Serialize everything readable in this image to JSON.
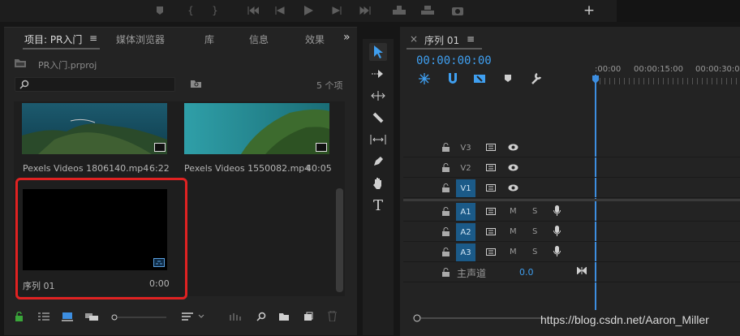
{
  "project_panel": {
    "tabs": [
      {
        "label": "项目: PR入门"
      },
      {
        "label": "媒体浏览器"
      },
      {
        "label": "库"
      },
      {
        "label": "信息"
      },
      {
        "label": "效果"
      }
    ],
    "overflow_glyph": "»",
    "menu_glyph": "≡",
    "project_file": "PR入门.prproj",
    "search_placeholder": "",
    "item_count": "5 个项",
    "items": [
      {
        "name": "Pexels Videos 1806140.mp4",
        "duration": "6:22"
      },
      {
        "name": "Pexels Videos 1550082.mp4",
        "duration": "40:05"
      },
      {
        "name": "序列 01",
        "duration": "0:00"
      }
    ]
  },
  "sequence_panel": {
    "close_glyph": "×",
    "tab_label": "序列 01",
    "menu_glyph": "≡",
    "timecode": "00:00:00:00",
    "ruler": [
      ":00:00",
      "00:00:15:00",
      "00:00:30:00"
    ],
    "video_tracks": [
      {
        "label": "V3",
        "active": false
      },
      {
        "label": "V2",
        "active": false
      },
      {
        "label": "V1",
        "active": true
      }
    ],
    "audio_tracks": [
      {
        "label": "A1",
        "m": "M",
        "s": "S"
      },
      {
        "label": "A2",
        "m": "M",
        "s": "S"
      },
      {
        "label": "A3",
        "m": "M",
        "s": "S"
      }
    ],
    "master_label": "主声道",
    "master_value": "0.0"
  },
  "colors": {
    "accent": "#3f9ff0",
    "track_active": "#1b5a88",
    "highlight": "#e02222"
  },
  "watermark": "https://blog.csdn.net/Aaron_Miller"
}
